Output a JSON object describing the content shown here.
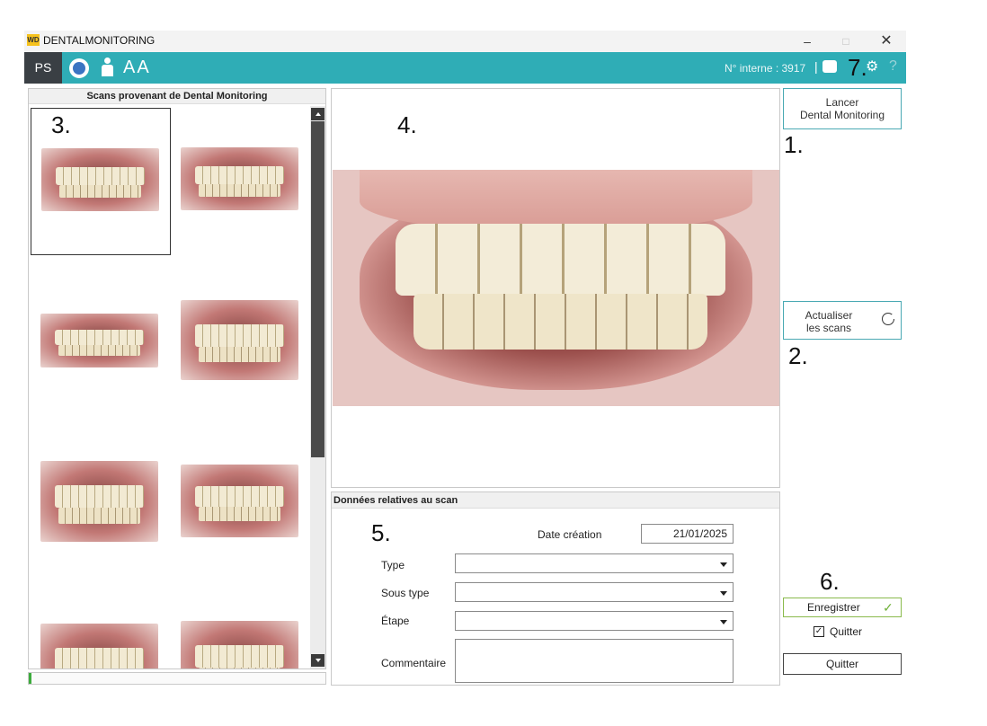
{
  "window": {
    "logo_text": "WD",
    "title": "DENTALMONITORING",
    "minimize": "–",
    "maximize": "□",
    "close": "✕"
  },
  "toolbar": {
    "ps_label": "PS",
    "font_size_label": "AA",
    "internal_number": "N° interne : 3917",
    "separator": "|",
    "gear_icon": "⚙",
    "help_icon": "?"
  },
  "scans_panel": {
    "header": "Scans provenant de Dental Monitoring",
    "thumbnail_count": 8,
    "selected_index": 0
  },
  "scan_data": {
    "header": "Données relatives au scan",
    "date_label": "Date création",
    "date_value": "21/01/2025",
    "type_label": "Type",
    "type_value": "",
    "subtype_label": "Sous type",
    "subtype_value": "",
    "step_label": "Étape",
    "step_value": "",
    "comment_label": "Commentaire",
    "comment_value": ""
  },
  "actions": {
    "launch_line1": "Lancer",
    "launch_line2": "Dental Monitoring",
    "refresh_line1": "Actualiser",
    "refresh_line2": "les scans",
    "save_label": "Enregistrer",
    "save_check": "✓",
    "quit_checkbox_label": "Quitter",
    "quit_checkbox_checked": true,
    "quit_button_label": "Quitter"
  },
  "annotations": {
    "n1": "1.",
    "n2": "2.",
    "n3": "3.",
    "n4": "4.",
    "n5": "5.",
    "n6": "6.",
    "n7": "7."
  },
  "colors": {
    "toolbar": "#2fadb6",
    "ps_button": "#3a3f44",
    "save_border": "#8aba4c",
    "button_border": "#4aa9b3"
  }
}
